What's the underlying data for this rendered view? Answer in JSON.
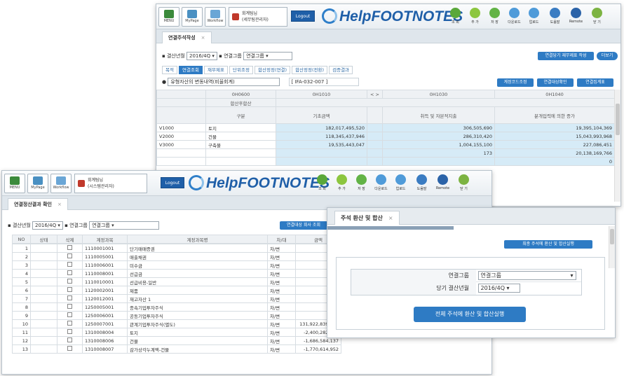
{
  "toolbar": {
    "menu": "MENU",
    "mypage": "MyPage",
    "workflow": "Workflow",
    "user_main": "회계팀님",
    "user_sub_main": "(세무팀관리자)",
    "user_sub_front": "(시스템관리자)",
    "logout": "Logout",
    "logo": "HelpFOOTNOTES",
    "buttons": [
      "조 회",
      "추 가",
      "저 장",
      "다운로드",
      "업로드",
      "도움말",
      "Remote",
      "닫 기"
    ],
    "buttons_front": [
      "조 회",
      "추 가",
      "저 장",
      "다운로드",
      "업로드",
      "도움말",
      "Remote",
      "닫 기"
    ]
  },
  "back": {
    "tab": "연결주석작성",
    "period_label": "결산년월",
    "period_value": "2016/4Q",
    "group_label": "연결그룹",
    "group_value": "연결그룹",
    "btn_right1": "연결당기 재무제표 작성",
    "btn_right2": "더보기",
    "subtabs": [
      "목적",
      "연결조회",
      "재무제표",
      "단위조정",
      "합산정정(연결)",
      "합산정정(전환)",
      "검증결과"
    ],
    "input_text": "유형자산의 변동내역(비율회계)",
    "code": "[ IFA-032-007 ]",
    "btn_a": "계정코드조정",
    "btn_b": "연결대상확인",
    "btn_c": "연결집계표",
    "col_codes": [
      "0H0600",
      "0H1010",
      "0H1030",
      "0H1040"
    ],
    "subheader": "합산후합산",
    "headers": [
      "구분",
      "기초금액",
      "취득 및 자본적지출",
      "분개입력에 의한 증가"
    ],
    "rows": [
      {
        "code": "V1000",
        "name": "토지",
        "a": "182,017,495,520",
        "b": "306,505,690",
        "c": "19,395,104,369"
      },
      {
        "code": "V2000",
        "name": "건물",
        "a": "118,345,437,946",
        "b": "286,310,420",
        "c": "15,043,993,968"
      },
      {
        "code": "V3000",
        "name": "구축물",
        "a": "19,535,443,047",
        "b": "1,004,155,100",
        "c": "227,086,451"
      },
      {
        "code": "",
        "name": "",
        "a": "",
        "b": "173",
        "c": "20,138,169,766"
      },
      {
        "code": "",
        "name": "",
        "a": "",
        "b": "",
        "c": "0"
      }
    ]
  },
  "front": {
    "tab": "연결정산결과 확인",
    "period_label": "결산년월",
    "period_value": "2016/4Q",
    "group_label": "연결그룹",
    "group_value": "연결그룹",
    "btn_right": "연결대상 회사 조회",
    "headers": [
      "NO",
      "상태",
      "삭제",
      "계정과목",
      "계정과목명",
      "차/대",
      "금액"
    ],
    "rows": [
      {
        "no": "1",
        "code": "1110001001",
        "name": "단기매매증권",
        "dc": "차/변",
        "amt": ""
      },
      {
        "no": "2",
        "code": "1110005001",
        "name": "매출채권",
        "dc": "차/변",
        "amt": ""
      },
      {
        "no": "3",
        "code": "1110006001",
        "name": "미수금",
        "dc": "차/변",
        "amt": ""
      },
      {
        "no": "4",
        "code": "1110008001",
        "name": "선급금",
        "dc": "차/변",
        "amt": ""
      },
      {
        "no": "5",
        "code": "1110010001",
        "name": "선급비용-일반",
        "dc": "차/변",
        "amt": ""
      },
      {
        "no": "6",
        "code": "1120002001",
        "name": "제품",
        "dc": "차/변",
        "amt": ""
      },
      {
        "no": "7",
        "code": "1120012001",
        "name": "재고자산 1",
        "dc": "차/변",
        "amt": ""
      },
      {
        "no": "8",
        "code": "1250005001",
        "name": "종속기업투자주식",
        "dc": "차/변",
        "amt": ""
      },
      {
        "no": "9",
        "code": "1250006001",
        "name": "공동기업투자주식",
        "dc": "차/변",
        "amt": ""
      },
      {
        "no": "10",
        "code": "1250007001",
        "name": "관계기업투자주식(별도)",
        "dc": "차/변",
        "amt": "131,922,839,691"
      },
      {
        "no": "11",
        "code": "1310008004",
        "name": "토지",
        "dc": "차/변",
        "amt": "-2,400,282,689"
      },
      {
        "no": "12",
        "code": "1310008006",
        "name": "건물",
        "dc": "차/변",
        "amt": "-1,686,584,137"
      },
      {
        "no": "13",
        "code": "1310008007",
        "name": "감가상각누계액-건물",
        "dc": "차/변",
        "amt": "-1,770,614,952"
      }
    ]
  },
  "dialog": {
    "tab": "주석 환산 및 합산",
    "btn_top": "최종 주석에 환산 및 합산실행",
    "group_label": "연결그룹",
    "group_value": "연결그룹",
    "period_label": "당기 결산년월",
    "period_value": "2016/4Q",
    "exec_button": "전체 주석에 환산 및 합산실행"
  },
  "colors": {
    "accent": "#2e7bc4",
    "header_bg": "#eef1f4",
    "highlight": "#d6ebf7",
    "logo": "#1f5fa8"
  }
}
